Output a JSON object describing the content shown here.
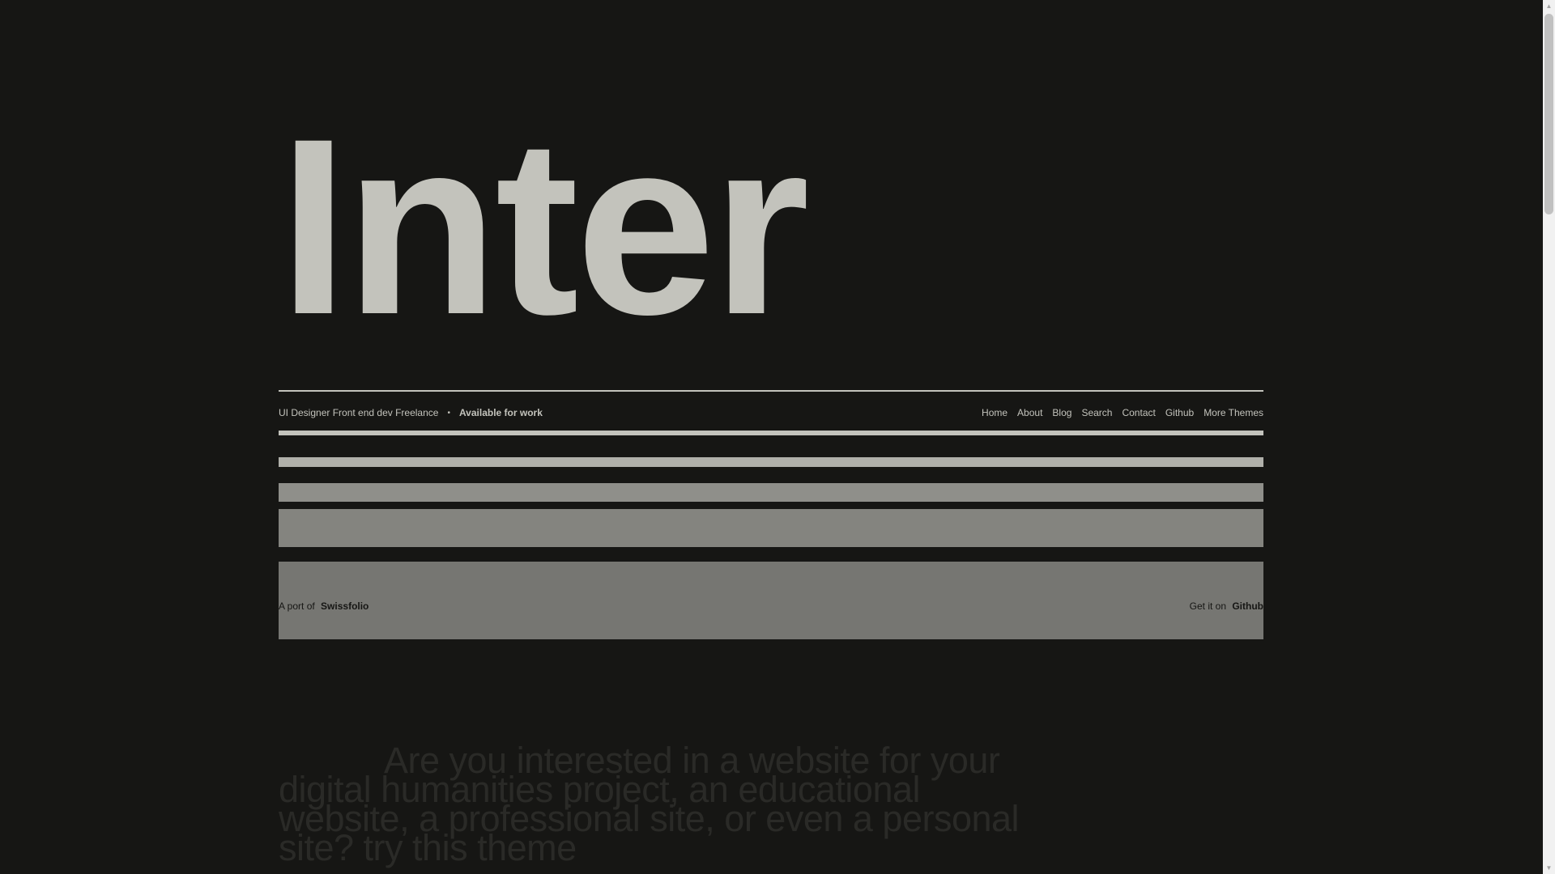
{
  "hero": {
    "title": "Inter"
  },
  "nav": {
    "role": "UI Designer Front end dev Freelance",
    "separator": "•",
    "status": "Available for work",
    "links": [
      "Home",
      "About",
      "Blog",
      "Search",
      "Contact",
      "Github",
      "More Themes"
    ]
  },
  "credits": {
    "port_prefix": "A port of",
    "port_name": "Swissfolio",
    "get_prefix": "Get it on",
    "get_name": "Github"
  },
  "pitch": {
    "text": "Are you interested in a website for your digital humanities project, an educational website, a professional site, or even a personal site? try this theme"
  },
  "colors": {
    "background": "#161614",
    "foreground": "#c3c3bc"
  }
}
